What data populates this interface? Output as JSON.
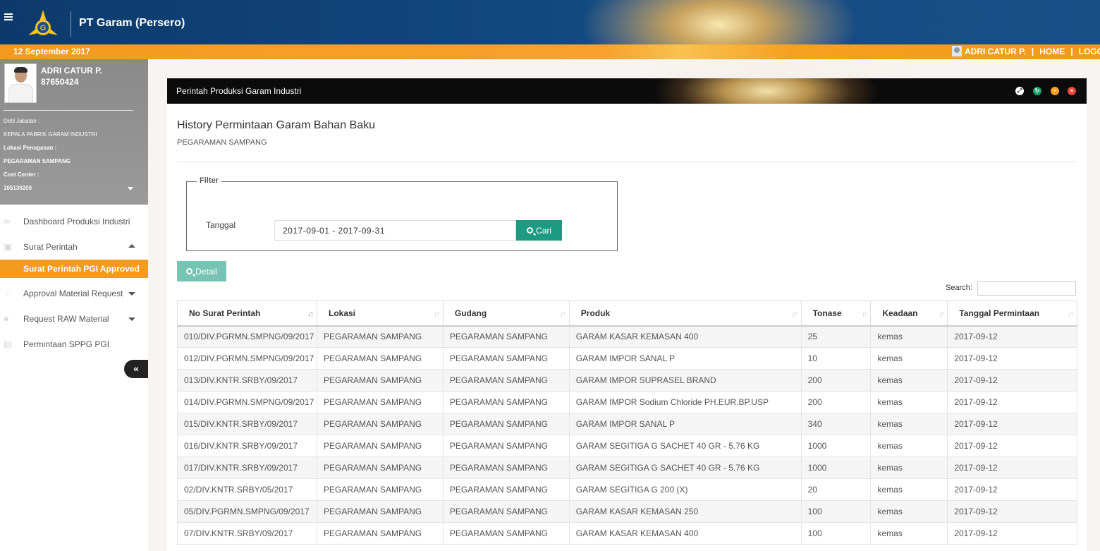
{
  "header": {
    "company": "PT Garam (Persero)",
    "date": "12 September 2017",
    "user": "ADRI CATUR P.",
    "home": "HOME",
    "logout": "LOGOUT",
    "sep": "|"
  },
  "profile": {
    "name": "ADRI CATUR P.",
    "id": "87650424",
    "jabatan_label": "Detil Jabatan :",
    "jabatan": "KEPALA PABRIK GARAM INDUSTRI",
    "lokasi_label": "Lokasi Penugasan :",
    "lokasi": "PEGARAMAN SAMPANG",
    "cost_label": "Cost Center :",
    "cost": "105130200"
  },
  "nav": {
    "dashboard": "Dashboard Produksi Industri",
    "surat_perintah": "Surat Perintah",
    "surat_pgi": "Surat Perintah PGI Approved",
    "approval": "Approval Material Request",
    "request_raw": "Request RAW Material",
    "permintaan": "Permintaan SPPG PGI",
    "collapse": "«"
  },
  "panel": {
    "title": "Perintah Produksi Garam Industri",
    "page_title": "History Permintaan Garam Bahan Baku",
    "page_sub": "PEGARAMAN SAMPANG"
  },
  "filter": {
    "legend": "Filter",
    "label": "Tanggal",
    "date_range": "2017-09-01 - 2017-09-31",
    "cari": "Cari"
  },
  "actions": {
    "detail": "Detail",
    "search_label": "Search:"
  },
  "table": {
    "columns": [
      "No Surat Perintah",
      "Lokasi",
      "Gudang",
      "Produk",
      "Tonase",
      "Keadaan",
      "Tanggal Permintaan"
    ],
    "rows": [
      [
        "010/DIV.PGRMN.SMPNG/09/2017",
        "PEGARAMAN SAMPANG",
        "PEGARAMAN SAMPANG",
        "GARAM KASAR KEMASAN 400",
        "25",
        "kemas",
        "2017-09-12"
      ],
      [
        "012/DIV.PGRMN.SMPNG/09/2017",
        "PEGARAMAN SAMPANG",
        "PEGARAMAN SAMPANG",
        "GARAM IMPOR SANAL P",
        "10",
        "kemas",
        "2017-09-12"
      ],
      [
        "013/DIV.KNTR.SRBY/09/2017",
        "PEGARAMAN SAMPANG",
        "PEGARAMAN SAMPANG",
        "GARAM IMPOR SUPRASEL BRAND",
        "200",
        "kemas",
        "2017-09-12"
      ],
      [
        "014/DIV.PGRMN.SMPNG/09/2017",
        "PEGARAMAN SAMPANG",
        "PEGARAMAN SAMPANG",
        "GARAM IMPOR Sodium Chloride PH.EUR.BP.USP",
        "200",
        "kemas",
        "2017-09-12"
      ],
      [
        "015/DIV.KNTR.SRBY/09/2017",
        "PEGARAMAN SAMPANG",
        "PEGARAMAN SAMPANG",
        "GARAM IMPOR SANAL P",
        "340",
        "kemas",
        "2017-09-12"
      ],
      [
        "016/DIV.KNTR.SRBY/09/2017",
        "PEGARAMAN SAMPANG",
        "PEGARAMAN SAMPANG",
        "GARAM SEGITIGA G SACHET 40 GR - 5.76 KG",
        "1000",
        "kemas",
        "2017-09-12"
      ],
      [
        "017/DIV.KNTR.SRBY/09/2017",
        "PEGARAMAN SAMPANG",
        "PEGARAMAN SAMPANG",
        "GARAM SEGITIGA G SACHET 40 GR - 5.76 KG",
        "1000",
        "kemas",
        "2017-09-12"
      ],
      [
        "02/DIV.KNTR.SRBY/05/2017",
        "PEGARAMAN SAMPANG",
        "PEGARAMAN SAMPANG",
        "GARAM SEGITIGA G 200 (X)",
        "20",
        "kemas",
        "2017-09-12"
      ],
      [
        "05/DIV.PGRMN.SMPNG/09/2017",
        "PEGARAMAN SAMPANG",
        "PEGARAMAN SAMPANG",
        "GARAM KASAR KEMASAN 250",
        "100",
        "kemas",
        "2017-09-12"
      ],
      [
        "07/DIV.KNTR.SRBY/09/2017",
        "PEGARAMAN SAMPANG",
        "PEGARAMAN SAMPANG",
        "GARAM KASAR KEMASAN 400",
        "100",
        "kemas",
        "2017-09-12"
      ]
    ]
  },
  "colors": {
    "header_blue": "#0c3a6b",
    "orange": "#f49a20",
    "teal": "#1d9a82",
    "teal_light": "#77c4b5"
  }
}
